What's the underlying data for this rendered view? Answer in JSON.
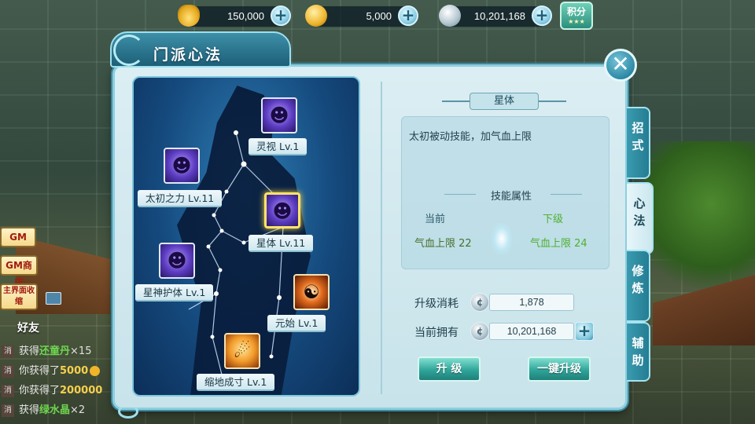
{
  "currencies": [
    {
      "icon": "gold-ingot-icon",
      "value": "150,000"
    },
    {
      "icon": "gold-coin-icon",
      "value": "5,000"
    },
    {
      "icon": "silver-coin-icon",
      "value": "10,201,168"
    }
  ],
  "jifen_label": "积分",
  "panel": {
    "title": "门派心法",
    "close_symbol": "✕"
  },
  "skills": [
    {
      "name": "灵视 Lv.1",
      "icon": "spirit-vision-icon"
    },
    {
      "name": "太初之力 Lv.11",
      "icon": "primal-power-icon"
    },
    {
      "name": "星体 Lv.11",
      "icon": "star-body-icon",
      "selected": true
    },
    {
      "name": "星神护体 Lv.1",
      "icon": "star-guardian-icon"
    },
    {
      "name": "元始 Lv.1",
      "icon": "yuanshi-icon"
    },
    {
      "name": "缩地成寸 Lv.1",
      "icon": "shrink-earth-icon"
    }
  ],
  "detail": {
    "skill_name": "星体",
    "description": "太初被动技能，加气血上限",
    "attr_title": "技能属性",
    "current_label": "当前",
    "next_label": "下级",
    "current_value": "气血上限 22",
    "next_value": "气血上限 24",
    "upgrade_cost_label": "升级消耗",
    "upgrade_cost_value": "1,878",
    "owned_label": "当前拥有",
    "owned_value": "10,201,168",
    "upgrade_button": "升 级",
    "one_click_button": "一键升级"
  },
  "side_tabs": [
    {
      "label": "招\n式",
      "active": false
    },
    {
      "label": "心\n法",
      "active": true
    },
    {
      "label": "修\n炼",
      "active": false
    },
    {
      "label": "辅\n助",
      "active": false
    }
  ],
  "hud": {
    "gm_button": "GM",
    "gm_shop_button": "GM商店",
    "collapse_button": "主界面收缩",
    "friend_title": "好友"
  },
  "chat": [
    {
      "tag": "消",
      "prefix": "获得",
      "item": "还童丹",
      "suffix": "×15",
      "color": "item"
    },
    {
      "tag": "消",
      "prefix": "你获得了",
      "item": "5000",
      "suffix": "",
      "color": "gold"
    },
    {
      "tag": "消",
      "prefix": "你获得了",
      "item": "200000",
      "suffix": "",
      "color": "gold"
    },
    {
      "tag": "消",
      "prefix": "获得",
      "item": "绿水晶",
      "suffix": "×2",
      "color": "item"
    }
  ],
  "colors": {
    "panel_bg": "#dbeef3",
    "accent_teal": "#2fa59a",
    "current_value": "#4a6f2a",
    "next_value": "#4fb02f"
  }
}
